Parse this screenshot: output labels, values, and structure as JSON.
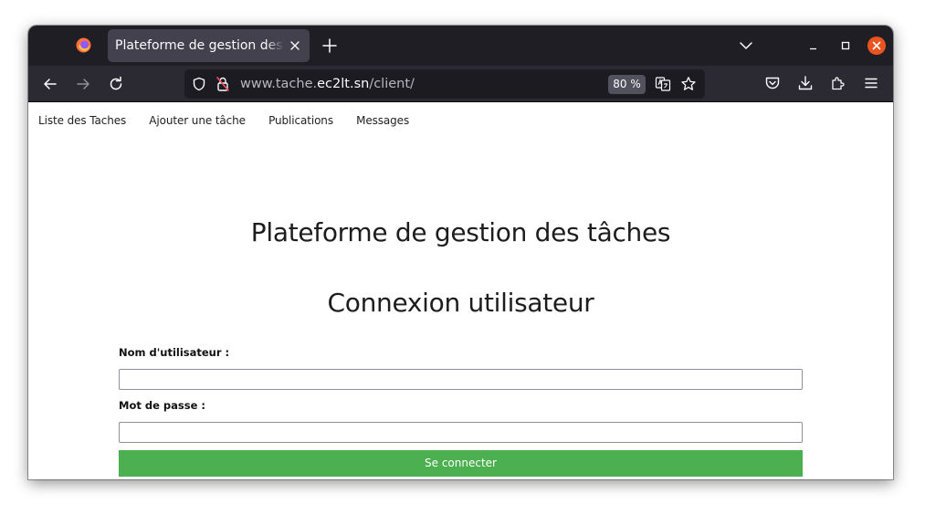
{
  "browser": {
    "tab_title": "Plateforme de gestion des tâches",
    "url_prefix": "www.tache.",
    "url_domain": "ec2lt.sn",
    "url_path": "/client/",
    "zoom": "80 %"
  },
  "site_nav": [
    "Liste des Taches",
    "Ajouter une tâche",
    "Publications",
    "Messages"
  ],
  "page": {
    "title": "Plateforme de gestion des tâches",
    "form_title": "Connexion utilisateur",
    "username_label": "Nom d'utilisateur :",
    "password_label": "Mot de passe :",
    "username_value": "",
    "password_value": "",
    "submit_label": "Se connecter"
  },
  "colors": {
    "submit_bg": "#4caf50",
    "window_close": "#e95420"
  }
}
